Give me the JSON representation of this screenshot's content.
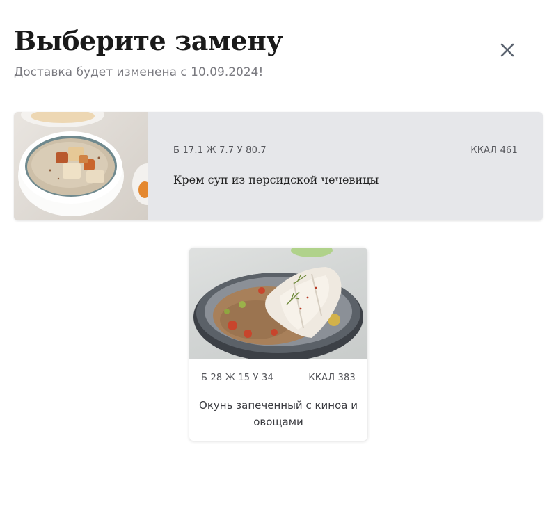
{
  "header": {
    "title": "Выберите замену",
    "subtitle": "Доставка будет изменена с 10.09.2024!"
  },
  "close": {
    "icon": "close-icon"
  },
  "current_dish": {
    "macros": "Б 17.1 Ж 7.7 У 80.7",
    "kcal": "ККАЛ 461",
    "name": "Крем суп из персидской чечевицы",
    "image": "soup-bowl-image"
  },
  "options": [
    {
      "macros": "Б 28 Ж 15 У 34",
      "kcal": "ККАЛ 383",
      "name": "Окунь запеченный с киноа и овощами",
      "image": "fish-quinoa-plate-image"
    }
  ],
  "colors": {
    "current_card_bg": "#e6e7ea",
    "subtitle": "#7a7a80",
    "close_icon": "#5c6470"
  }
}
